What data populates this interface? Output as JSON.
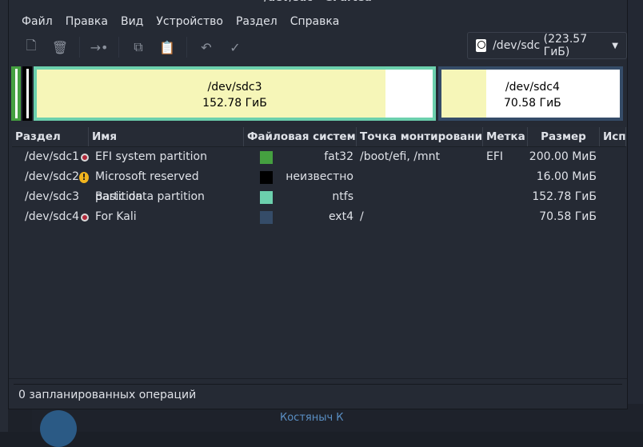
{
  "window": {
    "title": "/dev/sdc - GParted"
  },
  "menu": [
    "Файл",
    "Правка",
    "Вид",
    "Устройство",
    "Раздел",
    "Справка"
  ],
  "device": {
    "label": "/dev/sdc",
    "size": "(223.57 ГиБ)"
  },
  "map": [
    {
      "name": "/dev/sdc3",
      "size": "152.78 ГиБ"
    },
    {
      "name": "/dev/sdc4",
      "size": "70.58 ГиБ"
    }
  ],
  "columns": [
    "Раздел",
    "Имя",
    "Файловая система",
    "Точка монтирования",
    "Метка",
    "Размер",
    "Исп"
  ],
  "rows": [
    {
      "partition": "/dev/sdc1",
      "status": "mounted",
      "name": "EFI system partition",
      "color": "#45a040",
      "fs": "fat32",
      "mount": "/boot/efi, /mnt",
      "label": "EFI",
      "size": "200.00 МиБ"
    },
    {
      "partition": "/dev/sdc2",
      "status": "warning",
      "name": "Microsoft reserved partition",
      "color": "#000000",
      "fs": "неизвестно",
      "mount": "",
      "label": "",
      "size": "16.00 МиБ"
    },
    {
      "partition": "/dev/sdc3",
      "status": "",
      "name": "Basic data partition",
      "color": "#6cd0ad",
      "fs": "ntfs",
      "mount": "",
      "label": "",
      "size": "152.78 ГиБ"
    },
    {
      "partition": "/dev/sdc4",
      "status": "mounted",
      "name": "For Kali",
      "color": "#354c68",
      "fs": "ext4",
      "mount": "/",
      "label": "",
      "size": "70.58 ГиБ"
    }
  ],
  "status": "0 запланированных операций",
  "background": {
    "chat_name": "Костяныч К"
  }
}
